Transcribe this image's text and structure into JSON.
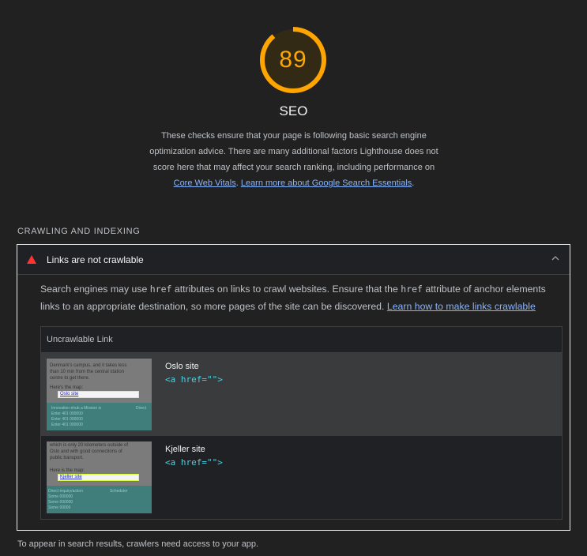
{
  "category": {
    "score": "89",
    "score_fraction": 0.89,
    "title": "SEO",
    "description_text": "These checks ensure that your page is following basic search engine optimization advice. There are many additional factors Lighthouse does not score here that may affect your search ranking, including performance on ",
    "link_cwv": "Core Web Vitals",
    "sep": ". ",
    "link_learn": "Learn more about Google Search Essentials",
    "end": ".",
    "color_score": "#ffa400"
  },
  "section": {
    "title": "Crawling and Indexing"
  },
  "audit": {
    "title": "Links are not crawlable",
    "desc_1": "Search engines may use ",
    "code_1": "href",
    "desc_2": " attributes on links to crawl websites. Ensure that the ",
    "code_2": "href",
    "desc_3": " attribute of anchor elements links to an appropriate destination, so more pages of the site can be discovered. ",
    "learn_link": "Learn how to make links crawlable",
    "fail_color": "#ff3333",
    "table": {
      "header": "Uncrawlable Link",
      "rows": [
        {
          "label": "Oslo site",
          "code": "<a href=\"\">",
          "thumb": {
            "lines": [
              "Denmark's campus, and it takes less",
              "than 10 min from the central station",
              "centre to get there.",
              "",
              "Here's the map:"
            ],
            "highlight": "Oslo site",
            "bottom": [
              "Innovation ehub a Mission is",
              "Enter 401 000000",
              "Enter 401 000000",
              "Enter 401 000000"
            ],
            "bottom_right": "Direct"
          }
        },
        {
          "label": "Kjeller site",
          "code": "<a href=\"\">",
          "thumb": {
            "lines": [
              "which is only 20 kilometers outside of",
              "Oslo and with good connections of",
              "public transport.",
              "",
              "Here is the map:"
            ],
            "highlight": "Kjeller site",
            "bottom": [
              "Direct inquiry/action",
              "Some 000000",
              "Some 000000",
              "Some 00000"
            ],
            "bottom_right": "Scheduler"
          }
        }
      ]
    }
  },
  "footer": "To appear in search results, crawlers need access to your app."
}
